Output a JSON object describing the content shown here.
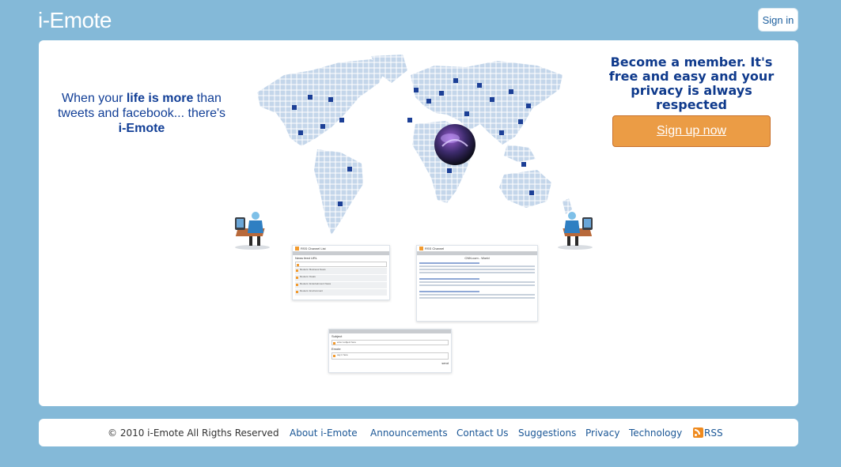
{
  "header": {
    "logo_text": "i-Emote",
    "signin_label": "Sign in"
  },
  "hero": {
    "tagline_part1": "When your ",
    "tagline_bold1": "life is more",
    "tagline_part2": " than tweets and facebook... there's ",
    "tagline_bold2": "i-Emote",
    "member_text": "Become a member. It's free and easy and your privacy is always respected",
    "signup_label": "Sign up now"
  },
  "previews": {
    "feed_list_title": "RSS Channel List",
    "feed_list_field": "News feed URL",
    "feed_list_button": "add feed",
    "feed_list_items": [
      "Reuters: Business News",
      "Reuters: Deals",
      "Reuters: Entertainment News",
      "Reuters: Environment",
      "Reuters: Green Business News"
    ],
    "channel_title": "RSS Channel",
    "channel_subheader": "CNN.com - World",
    "post_subject_label": "Subject",
    "post_subject_value": "enter subject here",
    "post_emote_label": "Emote",
    "post_emote_value": "say it here",
    "post_button": "send"
  },
  "footer": {
    "copyright": "© 2010 i-Emote All Rigths Reserved",
    "links": [
      "About i-Emote",
      "Announcements",
      "Contact Us",
      "Suggestions",
      "Privacy",
      "Technology"
    ],
    "rss_label": "RSS",
    "rss_icon": "rss-icon"
  },
  "colors": {
    "background": "#84b9d8",
    "signup_button": "#eb9c45",
    "heading_blue": "#0f3a8c",
    "link_blue": "#1b5796"
  }
}
